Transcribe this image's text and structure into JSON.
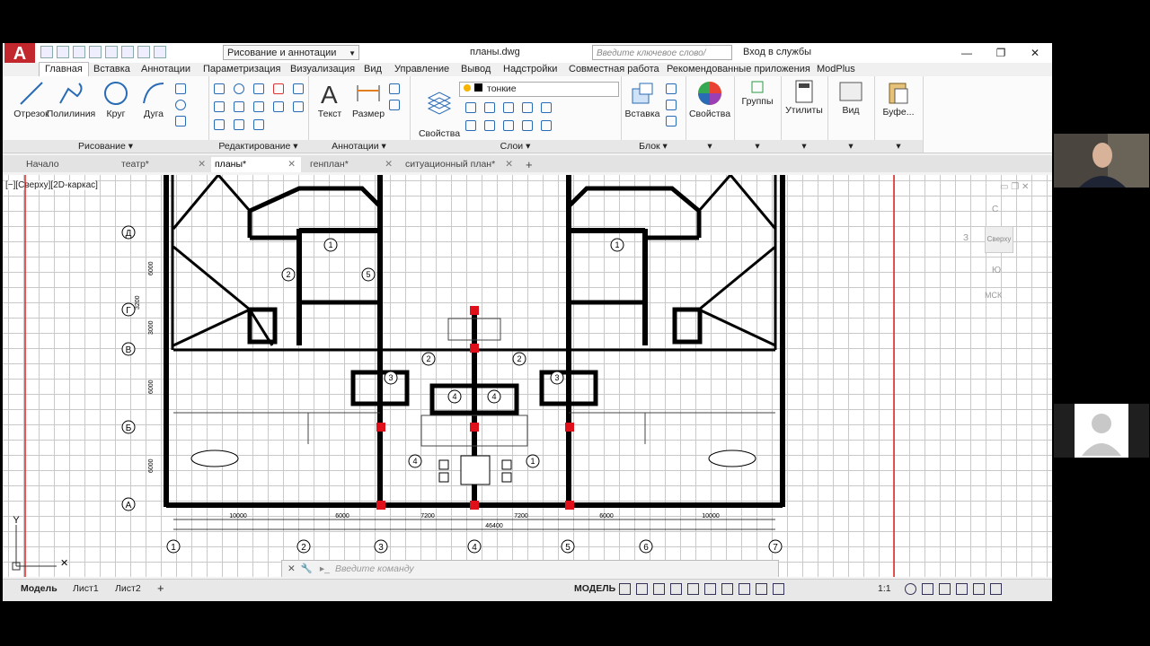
{
  "app": {
    "logo": "A",
    "document_title": "планы.dwg"
  },
  "workspace": {
    "label": "Рисование и аннотации"
  },
  "search": {
    "placeholder": "Введите ключевое слово/фразу"
  },
  "account": {
    "login_label": "Вход в службы"
  },
  "window_controls": {
    "minimize": "—",
    "restore": "❐",
    "close": "✕"
  },
  "menu_tabs": [
    "Главная",
    "Вставка",
    "Аннотации",
    "Параметризация",
    "Визуализация",
    "Вид",
    "Управление",
    "Вывод",
    "Надстройки",
    "Совместная работа",
    "Рекомендованные приложения",
    "ModPlus"
  ],
  "ribbon": {
    "draw": {
      "title": "Рисование",
      "tools": [
        "Отрезок",
        "Полилиния",
        "Круг",
        "Дуга"
      ]
    },
    "modify": {
      "title": "Редактирование"
    },
    "annotation": {
      "title": "Аннотации",
      "tools": [
        "Текст",
        "Размер"
      ]
    },
    "layers": {
      "title": "Слои",
      "props_label": "Свойства\nслоя",
      "current_layer": "тонкие"
    },
    "block": {
      "title": "Блок",
      "insert_label": "Вставка"
    },
    "properties_label": "Свойства",
    "groups_label": "Группы",
    "utilities_label": "Утилиты",
    "view_label": "Вид",
    "buffer_label": "Буфе..."
  },
  "doc_tabs": [
    {
      "label": "Начало",
      "closable": false
    },
    {
      "label": "театр*",
      "closable": true
    },
    {
      "label": "планы*",
      "closable": true,
      "active": true
    },
    {
      "label": "генплан*",
      "closable": true
    },
    {
      "label": "ситуационный план*",
      "closable": true
    }
  ],
  "viewport_label": "[−][Сверху][2D-каркас]",
  "viewcube": {
    "top": "Сверху",
    "north": "С",
    "west": "З",
    "south": "Ю",
    "ucs": "МСК"
  },
  "drawing": {
    "row_axes": [
      "Д",
      "Г",
      "В",
      "Б",
      "А"
    ],
    "col_axes": [
      "1",
      "2",
      "3",
      "4",
      "5",
      "6",
      "7"
    ],
    "col_dims": [
      "10000",
      "6000",
      "7200",
      "7200",
      "6000",
      "10000"
    ],
    "total_dim": "46400",
    "row_dims": [
      "6000",
      "3200",
      "3000",
      "6000",
      "6000"
    ],
    "room_numbers": [
      "1",
      "2",
      "5",
      "3",
      "4",
      "2",
      "2",
      "3",
      "4",
      "4",
      "1",
      "1"
    ]
  },
  "command": {
    "placeholder": "Введите команду"
  },
  "layout_tabs": [
    "Модель",
    "Лист1",
    "Лист2"
  ],
  "status": {
    "mode": "МОДЕЛЬ",
    "scale": "1:1"
  },
  "colors": {
    "accent": "#c1272d",
    "axis_red": "#e02020",
    "column": "#e0101a"
  }
}
